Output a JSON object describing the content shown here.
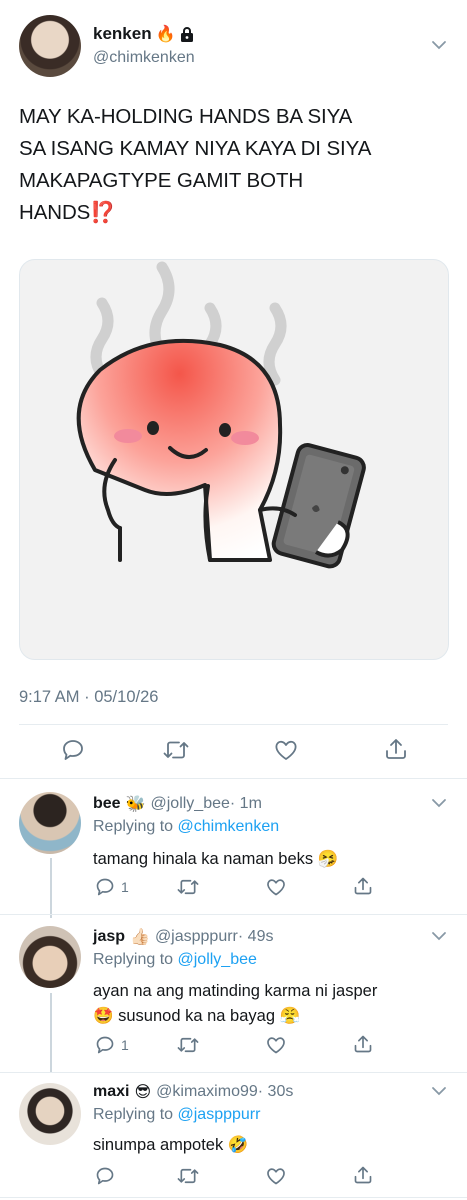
{
  "main_tweet": {
    "display_name": "kenken",
    "handle": "@chimkenken",
    "name_emojis": [
      "fire-emoji",
      "lock-icon"
    ],
    "text_lines": [
      "MAY KA-HOLDING HANDS BA SIYA",
      "SA ISANG KAMAY NIYA KAYA DI SIYA",
      "MAKAPAGTYPE GAMIT BOTH",
      "HANDS⁉️"
    ],
    "timestamp": "9:17 AM · 05/10/26"
  },
  "replies": [
    {
      "display_name": "bee",
      "name_emoji": "🐝",
      "handle": "@jolly_bee",
      "time": "· 1m",
      "replying_label": "Replying to",
      "replying_to": "@chimkenken",
      "text_lines": [
        "tamang hinala ka naman beks 🤧"
      ],
      "reply_count": "1"
    },
    {
      "display_name": "jasp",
      "name_emoji": "👍🏻",
      "handle": "@jaspppurr",
      "time": "· 49s",
      "replying_label": "Replying to",
      "replying_to": "@jolly_bee",
      "text_lines": [
        "ayan na ang matinding karma ni jasper",
        "🤩 susunod ka na bayag 😤"
      ],
      "reply_count": "1"
    },
    {
      "display_name": "maxi",
      "name_emoji": "😎",
      "handle": "@kimaximo99",
      "time": "· 30s",
      "replying_label": "Replying to",
      "replying_to": "@jaspppurr",
      "text_lines": [
        "sinumpa ampotek 🤣"
      ],
      "reply_count": ""
    }
  ],
  "colors": {
    "link": "#1da1f2",
    "muted": "#657786",
    "divider": "#e6ecf0",
    "thread_line": "#ccd6dd",
    "image_bg": "#f2f2f2"
  }
}
